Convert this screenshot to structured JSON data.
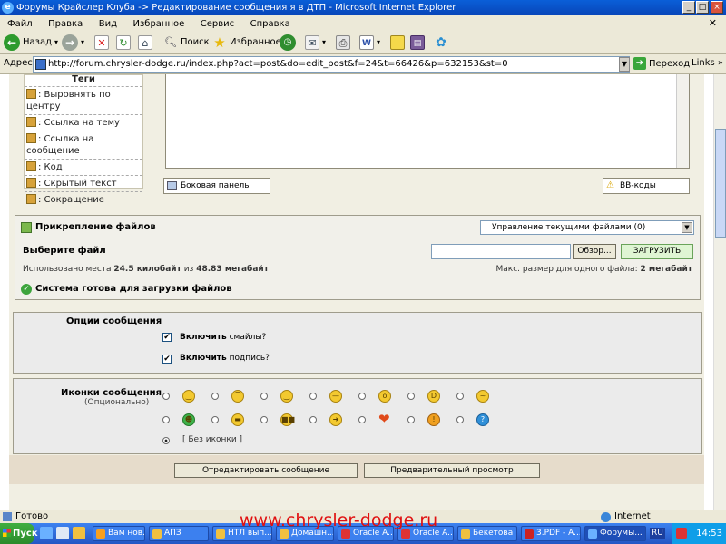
{
  "window": {
    "title": "Форумы Крайслер Клуба -> Редактирование сообщения я в ДТП - Microsoft Internet Explorer",
    "minimize": "_",
    "maximize": "□",
    "close": "×"
  },
  "menu": {
    "items": [
      "Файл",
      "Правка",
      "Вид",
      "Избранное",
      "Сервис",
      "Справка"
    ]
  },
  "toolbar": {
    "back_label": "Назад",
    "search_label": "Поиск",
    "favorites_label": "Избранное"
  },
  "address": {
    "label": "Адрес:",
    "url": "http://forum.chrysler-dodge.ru/index.php?act=post&do=edit_post&f=24&t=66426&p=632153&st=0",
    "go_label": "Переход",
    "links_label": "Links"
  },
  "tags": {
    "title": "Теги",
    "items": [
      ": Выровнять по центру",
      ": Ссылка на тему",
      ": Ссылка на сообщение",
      ": Код",
      ": Скрытый текст",
      ": Сокращение"
    ]
  },
  "editor": {
    "side_panel_label": "Боковая панель",
    "bbcodes_label": "BB-коды"
  },
  "attachments": {
    "title": "Прикрепление файлов",
    "manage_select": "Управление текущими файлами (0)",
    "choose_label": "Выберите файл",
    "browse_label": "Обзор...",
    "upload_label": "ЗАГРУЗИТЬ",
    "used_prefix": "Использовано места",
    "used_value": "24.5 килобайт",
    "used_of": "из",
    "used_total": "48.83 мегабайт",
    "max_prefix": "Макс. размер для одного файла:",
    "max_value": "2 мегабайт",
    "ready_label": "Система готова для загрузки файлов"
  },
  "options": {
    "title": "Опции сообщения",
    "smilies_bold": "Включить",
    "smilies_rest": "смайлы?",
    "signature_bold": "Включить",
    "signature_rest": "подпись?"
  },
  "icons": {
    "title": "Иконки сообщения",
    "subtitle": "(Опционально)",
    "row1": [
      "smile",
      "frown",
      "content",
      "sleepy",
      "shocked",
      "laugh",
      "annoyed"
    ],
    "row2": [
      "green-face",
      "teeth",
      "cool",
      "arrow-right",
      "heart",
      "warning",
      "question"
    ],
    "no_icon_label": "[ Без иконки ]"
  },
  "buttons": {
    "edit_label": "Отредактировать сообщение",
    "preview_label": "Предварительный просмотр"
  },
  "status": {
    "text": "Готово",
    "zone": "Internet"
  },
  "taskbar": {
    "start_label": "Пуск",
    "tasks": [
      "Вам нов...",
      "АПЗ",
      "НТЛ вып...",
      "Домашн...",
      "Oracle A...",
      "Oracle A...",
      "Бекетова",
      "3.PDF - A...",
      "Форумы..."
    ],
    "lang": "RU",
    "clock": "14:53"
  },
  "watermark": "www.chrysler-dodge.ru"
}
